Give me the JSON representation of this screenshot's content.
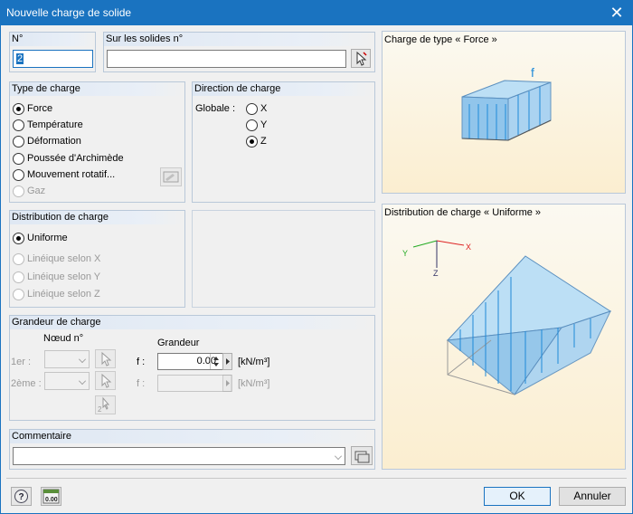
{
  "window": {
    "title": "Nouvelle charge de solide",
    "close": "✕"
  },
  "no": {
    "label": "N°",
    "value": "2"
  },
  "solids": {
    "label": "Sur les solides n°",
    "value": ""
  },
  "load_type": {
    "label": "Type de charge",
    "options": [
      "Force",
      "Température",
      "Déformation",
      "Poussée d'Archimède",
      "Mouvement rotatif...",
      "Gaz"
    ],
    "selected": "Force"
  },
  "direction": {
    "label": "Direction de charge",
    "axis_label": "Globale :",
    "options": [
      "X",
      "Y",
      "Z"
    ],
    "selected": "Z"
  },
  "distribution": {
    "label": "Distribution de charge",
    "options": [
      "Uniforme",
      "Linéique selon X",
      "Linéique selon Y",
      "Linéique selon Z"
    ],
    "selected": "Uniforme"
  },
  "magnitude": {
    "label": "Grandeur de charge",
    "node_header": "Nœud n°",
    "value_header": "Grandeur",
    "row1_label": "1er :",
    "row2_label": "2ème :",
    "f1_label": "f :",
    "f1_value": "0.00",
    "f2_label": "f :",
    "f2_value": "",
    "unit": "[kN/m³]"
  },
  "comment": {
    "label": "Commentaire",
    "value": ""
  },
  "preview_type": {
    "caption": "Charge de type «  Force »",
    "force_symbol": "f"
  },
  "preview_dist": {
    "caption": "Distribution de charge « Uniforme »",
    "axis_x": "X",
    "axis_y": "Y",
    "axis_z": "Z"
  },
  "buttons": {
    "ok": "OK",
    "cancel": "Annuler"
  },
  "colors": {
    "accent": "#1a73c0",
    "load_fill": "#8cc3ec",
    "load_arrow": "#1f8ad8",
    "preview_bg": "#fbeed0"
  }
}
